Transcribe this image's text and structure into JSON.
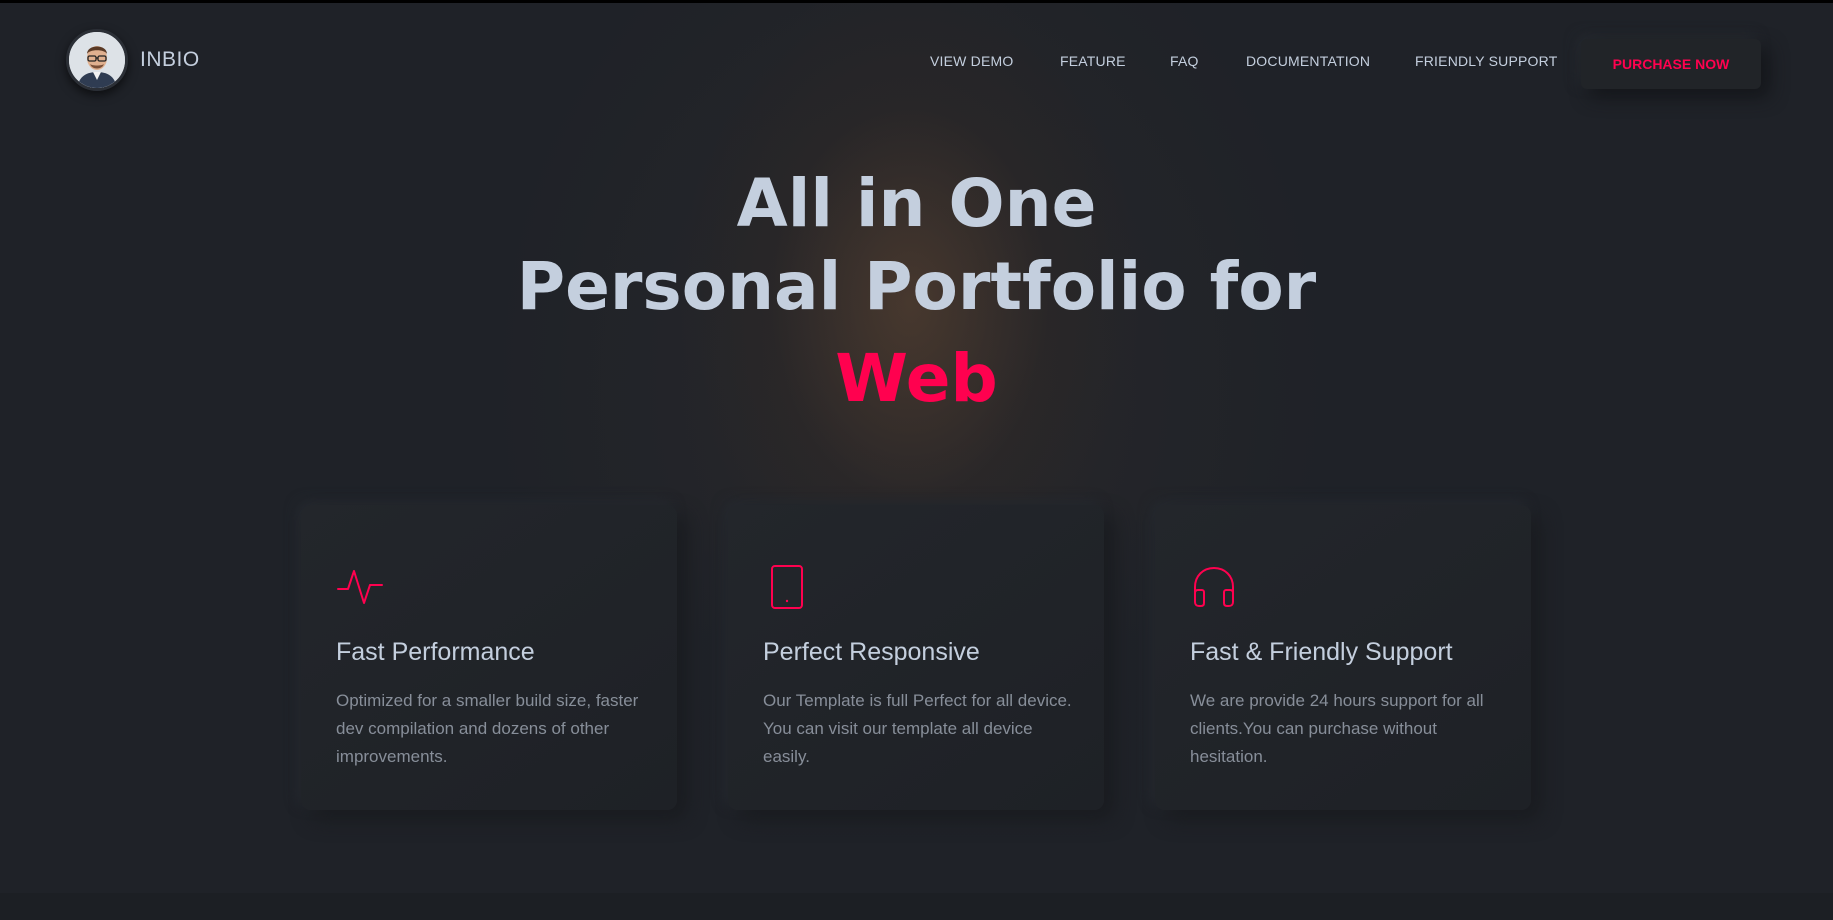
{
  "brand": {
    "name": "INBIO"
  },
  "nav": {
    "items": [
      "VIEW DEMO",
      "FEATURE",
      "FAQ",
      "DOCUMENTATION",
      "FRIENDLY SUPPORT"
    ],
    "cta": "PURCHASE NOW"
  },
  "hero": {
    "line1": "All in One",
    "line2": "Personal Portfolio for",
    "line3": "Web"
  },
  "features": [
    {
      "icon": "activity-icon",
      "title": "Fast Performance",
      "text": "Optimized for a smaller build size, faster dev compilation and dozens of other improvements."
    },
    {
      "icon": "tablet-icon",
      "title": "Perfect Responsive",
      "text": "Our Template is full Perfect for all device. You can visit our template all device easily."
    },
    {
      "icon": "headphones-icon",
      "title": "Fast & Friendly Support",
      "text": "We are provide 24 hours support for all clients.You can purchase without hesitation."
    }
  ],
  "colors": {
    "accent": "#ff014f",
    "text": "#c4cfde",
    "muted": "#878e99",
    "background": "#1f2228"
  }
}
